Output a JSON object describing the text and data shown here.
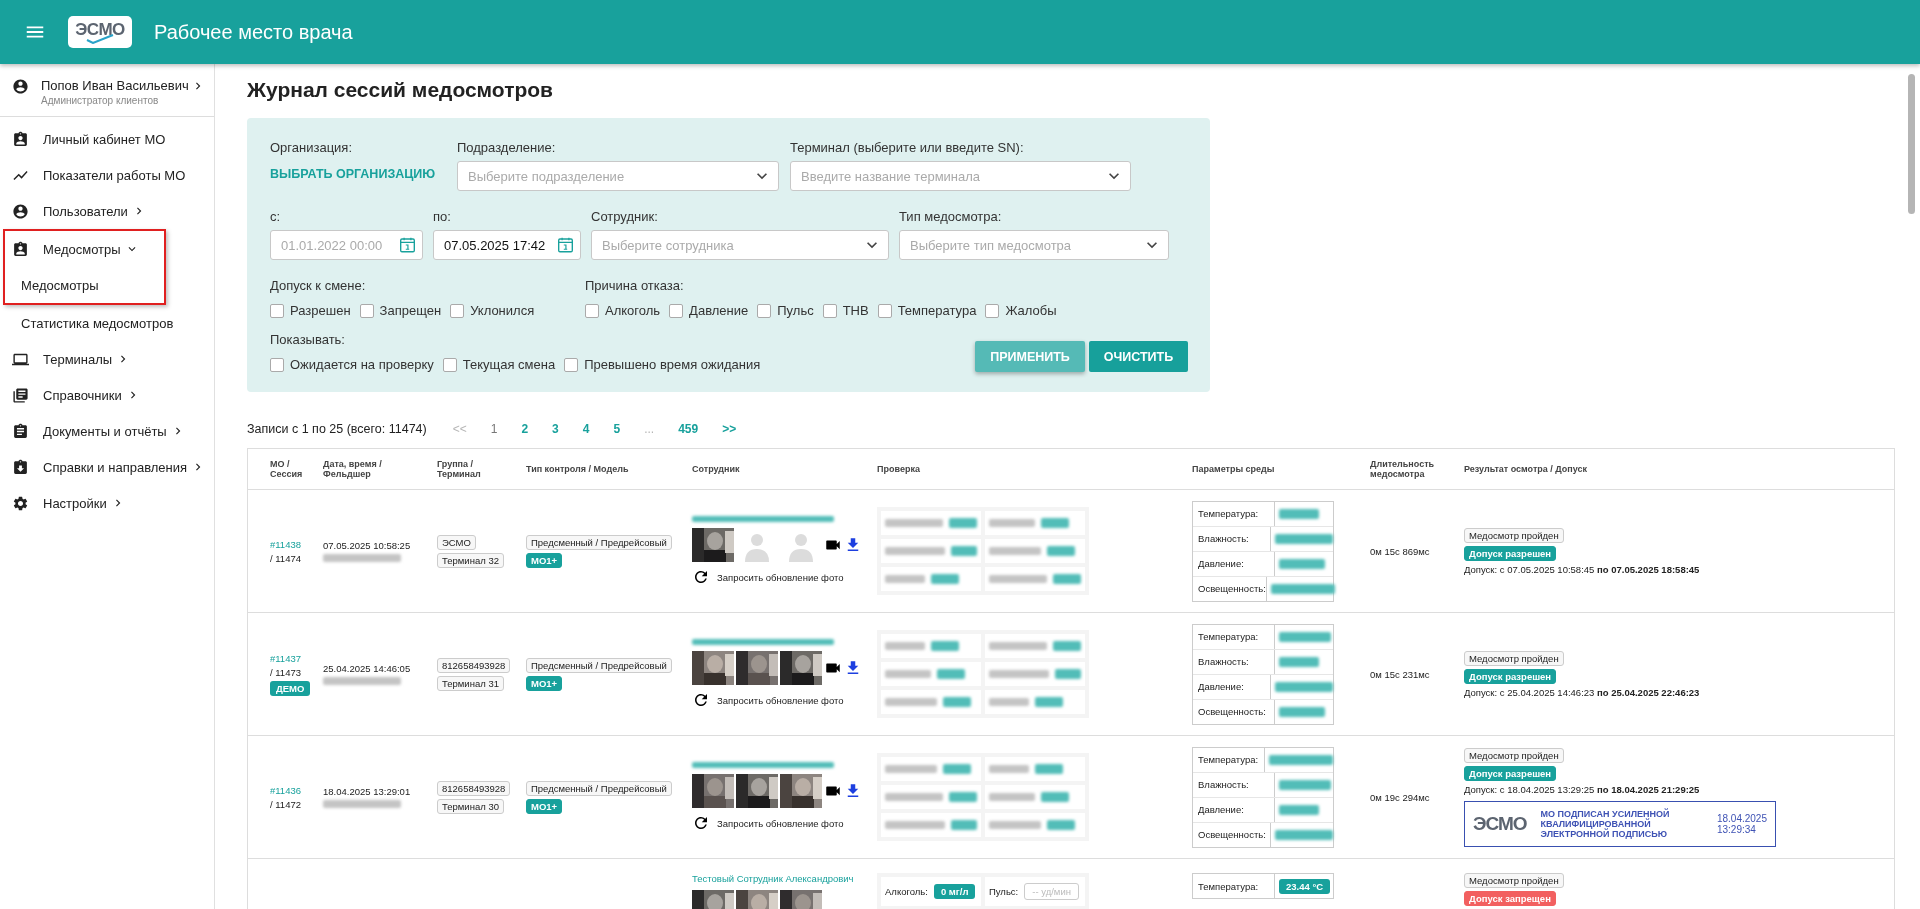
{
  "header": {
    "logo": "ЭСМО",
    "title": "Рабочее место врача"
  },
  "sidebar": {
    "user": {
      "name": "Попов Иван Васильевич",
      "role": "Администратор клиентов",
      "expanded": false
    },
    "items": [
      {
        "label": "Личный кабинет МО"
      },
      {
        "label": "Показатели работы МО"
      },
      {
        "label": "Пользователи",
        "expanded": false
      },
      {
        "label": "Медосмотры",
        "expanded": true,
        "highlighted": true,
        "children": [
          {
            "label": "Медосмотры",
            "highlighted": true
          },
          {
            "label": "Статистика медосмотров",
            "highlighted": false
          }
        ]
      },
      {
        "label": "Терминалы",
        "expanded": false
      },
      {
        "label": "Справочники",
        "expanded": false
      },
      {
        "label": "Документы и отчёты",
        "expanded": false
      },
      {
        "label": "Справки и направления",
        "expanded": false
      },
      {
        "label": "Настройки",
        "expanded": false
      }
    ]
  },
  "page_title": "Журнал сессий медосмотров",
  "filters": {
    "organization": {
      "label": "Организация:",
      "action": "ВЫБРАТЬ ОРГАНИЗАЦИЮ"
    },
    "fields_top": [
      {
        "label": "Подразделение:",
        "placeholder": "Выберите подразделение",
        "kind": "select"
      },
      {
        "label": "Терминал (выберите или введите SN):",
        "placeholder": "Введите название терминала",
        "kind": "select"
      }
    ],
    "fields_bottom": [
      {
        "label": "с:",
        "placeholder": "01.01.2022 00:00",
        "kind": "date"
      },
      {
        "label": "по:",
        "value": "07.05.2025 17:42",
        "kind": "date"
      },
      {
        "label": "Сотрудник:",
        "placeholder": "Выберите сотрудника",
        "kind": "select"
      },
      {
        "label": "Тип медосмотра:",
        "placeholder": "Выберите тип медосмотра",
        "kind": "select"
      }
    ],
    "groups": [
      {
        "label": "Допуск к смене:",
        "options": [
          {
            "label": "Разрешен",
            "checked": false
          },
          {
            "label": "Запрещен",
            "checked": false
          },
          {
            "label": "Уклонился",
            "checked": false
          }
        ]
      },
      {
        "label": "Причина отказа:",
        "options": [
          {
            "label": "Алкоголь",
            "checked": false
          },
          {
            "label": "Давление",
            "checked": false
          },
          {
            "label": "Пульс",
            "checked": false
          },
          {
            "label": "ТНВ",
            "checked": false
          },
          {
            "label": "Температура",
            "checked": false
          },
          {
            "label": "Жалобы",
            "checked": false
          }
        ]
      }
    ],
    "show": {
      "label": "Показывать:",
      "options": [
        {
          "label": "Ожидается на проверку",
          "checked": false
        },
        {
          "label": "Текущая смена",
          "checked": false
        },
        {
          "label": "Превышено время ожидания",
          "checked": false
        }
      ]
    },
    "buttons": [
      {
        "label": "ПРИМЕНИТЬ",
        "kind": "secondary"
      },
      {
        "label": "ОЧИСТИТЬ",
        "kind": "primary"
      }
    ]
  },
  "pager": {
    "summary": "Записи с 1 по 25 (всего: 11474)",
    "pages": [
      {
        "label": "<<",
        "selected": false,
        "disabled": true
      },
      {
        "label": "1",
        "selected": true,
        "disabled": false
      },
      {
        "label": "2",
        "selected": false,
        "disabled": false
      },
      {
        "label": "3",
        "selected": false,
        "disabled": false
      },
      {
        "label": "4",
        "selected": false,
        "disabled": false
      },
      {
        "label": "5",
        "selected": false,
        "disabled": false
      },
      {
        "label": "...",
        "selected": false,
        "disabled": true
      },
      {
        "label": "459",
        "selected": false,
        "disabled": false
      },
      {
        "label": ">>",
        "selected": false,
        "disabled": false
      }
    ]
  },
  "table": {
    "columns": [
      "МО /\nСессия",
      "Дата, время /\nФельдшер",
      "Группа /\nТерминал",
      "Тип контроля / Модель",
      "Сотрудник",
      "Проверка",
      "Параметры среды",
      "Длительность\nмедосмотра",
      "Результат осмотра / Допуск"
    ],
    "rows": [
      {
        "partial": false,
        "redacted": true,
        "mo": "#11438",
        "session": "/ 11474",
        "date": "07.05.2025 10:58:25",
        "group": "ЭСМО",
        "terminal": "Терминал 32",
        "type": "Предсменный / Предрейсовый",
        "model": "МО1+",
        "photos": [
          {
            "kind": "picture"
          },
          {
            "kind": "placeholder"
          },
          {
            "kind": "placeholder"
          }
        ],
        "refresh": "Запросить обновление фото",
        "env": [
          {
            "label": "Температура:"
          },
          {
            "label": "Влажность:"
          },
          {
            "label": "Давление:"
          },
          {
            "label": "Освещенность:"
          }
        ],
        "duration": "0м 15с 869мс",
        "result": "Медосмотр пройден",
        "admission": {
          "label": "Допуск разрешен",
          "allowed": true
        },
        "period": "Допуск: с 07.05.2025 10:58:45 **по 07.05.2025 18:58:45**"
      },
      {
        "partial": false,
        "redacted": true,
        "mo": "#11437",
        "session": "/ 11473",
        "badge": "ДЕМО",
        "date": "25.04.2025 14:46:05",
        "group": "812658493928",
        "terminal": "Терминал 31",
        "type": "Предсменный / Предрейсовый",
        "model": "МО1+",
        "photos": [
          {
            "kind": "picture"
          },
          {
            "kind": "picture"
          },
          {
            "kind": "picture"
          }
        ],
        "refresh": "Запросить обновление фото",
        "env": [
          {
            "label": "Температура:"
          },
          {
            "label": "Влажность:"
          },
          {
            "label": "Давление:"
          },
          {
            "label": "Освещенность:"
          }
        ],
        "duration": "0м 15с 231мс",
        "result": "Медосмотр пройден",
        "admission": {
          "label": "Допуск разрешен",
          "allowed": true
        },
        "period": "Допуск: с 25.04.2025 14:46:23 **по 25.04.2025 22:46:23**"
      },
      {
        "partial": false,
        "redacted": true,
        "mo": "#11436",
        "session": "/ 11472",
        "date": "18.04.2025 13:29:01",
        "group": "812658493928",
        "terminal": "Терминал 30",
        "type": "Предсменный / Предрейсовый",
        "model": "МО1+",
        "photos": [
          {
            "kind": "picture"
          },
          {
            "kind": "picture"
          },
          {
            "kind": "picture"
          }
        ],
        "refresh": "Запросить обновление фото",
        "env": [
          {
            "label": "Температура:"
          },
          {
            "label": "Влажность:"
          },
          {
            "label": "Давление:"
          },
          {
            "label": "Освещенность:"
          }
        ],
        "duration": "0м 19с 294мс",
        "result": "Медосмотр пройден",
        "admission": {
          "label": "Допуск разрешен",
          "allowed": true
        },
        "period": "Допуск: с 18.04.2025 13:29:25 **по 18.04.2025 21:29:25**",
        "signature": {
          "logo": "ЭСМО",
          "text": "МО ПОДПИСАН УСИЛЕННОЙ КВАЛИФИЦИРОВАННОЙ ЭЛЕКТРОННОЙ ПОДПИСЬЮ",
          "date": "18.04.2025",
          "time": "13:29:34"
        }
      },
      {
        "partial": true,
        "redacted": false,
        "employee": "Тестовый Сотрудник Александрович",
        "photos": [
          {
            "kind": "picture"
          },
          {
            "kind": "picture"
          },
          {
            "kind": "picture"
          }
        ],
        "check": [
          {
            "label": "Алкоголь:",
            "value": "0 мг/л",
            "measured": true
          },
          {
            "label": "Пульс:",
            "value": "-- уд/мин",
            "measured": false
          }
        ],
        "env": [
          {
            "label": "Температура:",
            "value": "23.44 °C"
          }
        ],
        "result": "Медосмотр пройден",
        "admission": {
          "label": "Допуск запрещен",
          "allowed": false
        }
      }
    ]
  }
}
